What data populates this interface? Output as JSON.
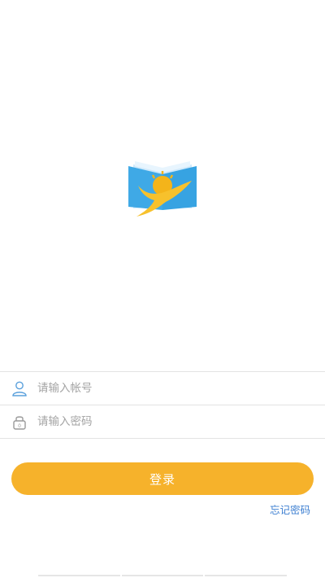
{
  "login": {
    "account_placeholder": "请输入帐号",
    "password_placeholder": "请输入密码",
    "login_label": "登录",
    "forgot_label": "忘记密码"
  },
  "colors": {
    "accent": "#f6b22b",
    "link": "#3d7fd1",
    "logo_blue": "#3fa9e6",
    "logo_yellow": "#f4b41a"
  },
  "icons": {
    "user": "user-icon",
    "lock": "lock-icon",
    "logo": "book-sun-bird-logo"
  }
}
